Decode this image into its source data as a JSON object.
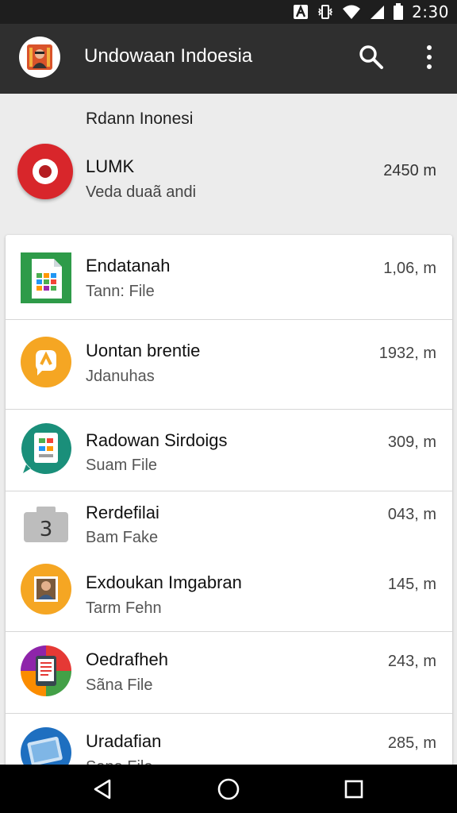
{
  "status_bar": {
    "time": "2:30"
  },
  "app_bar": {
    "title": "Undowaan Indoesia",
    "icons": [
      "app-avatar",
      "search-icon",
      "more-vert-icon"
    ]
  },
  "section": {
    "title": "Rdann Inonesi"
  },
  "featured": {
    "title": "LUMK",
    "subtitle": "Veda duaã andi",
    "size": "2450 m",
    "color": "#d8262b"
  },
  "files": [
    {
      "title": "Endatanah",
      "subtitle": "Tann: File",
      "size": "1,06, m",
      "icon": "spreadsheet-icon"
    },
    {
      "title": "Uontan brentie",
      "subtitle": "Jdanuhas",
      "size": "1932, m",
      "icon": "orange-app-icon"
    },
    {
      "title": "Radowan Sirdoigs",
      "subtitle": "Suam File",
      "size": "309, m",
      "icon": "chat-app-icon"
    },
    {
      "title": "Rerdefilai",
      "subtitle": "Bam Fake",
      "size": "043, m",
      "icon": "camera-icon"
    },
    {
      "title": "Exdoukan Imgabran",
      "subtitle": "Tarm Fehn",
      "size": "145, m",
      "icon": "photo-app-icon"
    },
    {
      "title": "Oedrafheh",
      "subtitle": "Sãna File",
      "size": "243, m",
      "icon": "reader-app-icon"
    },
    {
      "title": "Uradafian",
      "subtitle": "Sana File",
      "size": "285, m",
      "icon": "tablet-app-icon"
    }
  ],
  "nav": {
    "icons": [
      "back-icon",
      "home-icon",
      "recents-icon"
    ]
  }
}
